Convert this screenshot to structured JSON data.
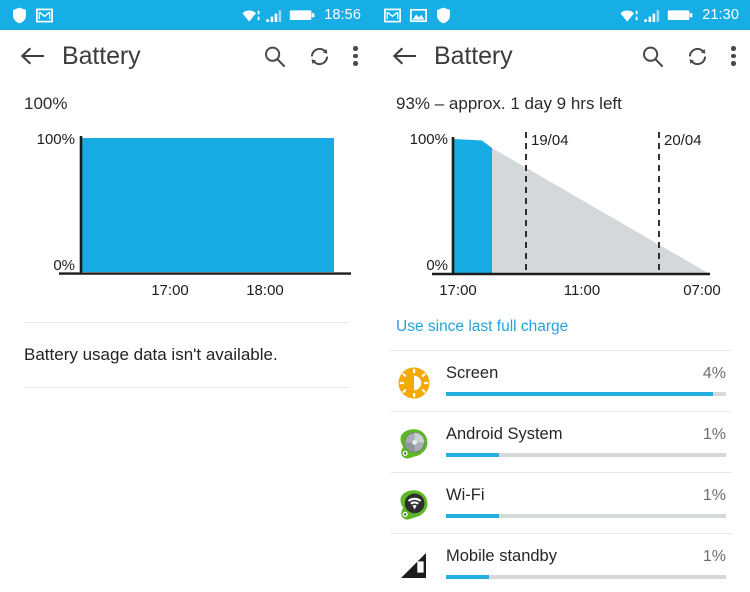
{
  "left": {
    "statusbar": {
      "icons": [
        "shield-icon",
        "gmail-icon"
      ],
      "wifi_icon": "wifi-icon",
      "signal_icon": "signal-bars-icon",
      "battery_icon": "battery-icon",
      "time": "18:56"
    },
    "toolbar": {
      "back_icon": "back-arrow-icon",
      "title": "Battery",
      "search_icon": "search-icon",
      "refresh_icon": "refresh-icon",
      "overflow_icon": "overflow-menu-icon"
    },
    "summary": "100%",
    "no_data_text": "Battery usage data isn't available.",
    "chart_data": {
      "type": "area",
      "title": "100%",
      "xlabel": "",
      "ylabel": "",
      "ylim": [
        0,
        100
      ],
      "y_ticks": [
        "0%",
        "100%"
      ],
      "x_ticks": [
        "17:00",
        "18:00"
      ],
      "grid": false,
      "legend": "none",
      "series": [
        {
          "name": "Battery level",
          "color": "#16ACE3",
          "points": [
            {
              "x": "16:20",
              "y": 100
            },
            {
              "x": "18:40",
              "y": 100
            }
          ]
        }
      ]
    }
  },
  "right": {
    "statusbar": {
      "icons": [
        "gmail-icon",
        "photos-icon",
        "shield-icon"
      ],
      "wifi_icon": "wifi-icon",
      "signal_icon": "signal-bars-icon",
      "battery_icon": "battery-icon",
      "time": "21:30"
    },
    "toolbar": {
      "back_icon": "back-arrow-icon",
      "title": "Battery",
      "search_icon": "search-icon",
      "refresh_icon": "refresh-icon",
      "overflow_icon": "overflow-menu-icon"
    },
    "summary": "93% – approx. 1 day 9 hrs left",
    "link_label": "Use since last full charge",
    "chart_data": {
      "type": "area",
      "title": "93% – approx. 1 day 9 hrs left",
      "xlabel": "",
      "ylabel": "",
      "ylim": [
        0,
        100
      ],
      "y_ticks": [
        "0%",
        "100%"
      ],
      "x_ticks": [
        "17:00",
        "11:00",
        "07:00"
      ],
      "annotations": [
        {
          "label": "19/04",
          "x_fraction": 0.3,
          "style": "dashed-vline"
        },
        {
          "label": "20/04",
          "x_fraction": 0.83,
          "style": "dashed-vline"
        }
      ],
      "grid": false,
      "legend": "none",
      "series": [
        {
          "name": "Battery level (recorded)",
          "color": "#16ACE3",
          "points": [
            {
              "x": "17:00",
              "y": 100
            },
            {
              "x": "18:30",
              "y": 97
            },
            {
              "x": "19:30",
              "y": 93
            }
          ]
        },
        {
          "name": "Projected remaining",
          "color": "#D3D9DA",
          "points": [
            {
              "x": "19:30",
              "y": 93
            },
            {
              "x": "07:00",
              "y": 0
            }
          ]
        }
      ]
    },
    "usage": {
      "items": [
        {
          "name": "Screen",
          "percent": "4%",
          "fill": 0.955,
          "icon": "screen-brightness-icon"
        },
        {
          "name": "Android System",
          "percent": "1%",
          "fill": 0.19,
          "icon": "android-system-icon"
        },
        {
          "name": "Wi-Fi",
          "percent": "1%",
          "fill": 0.19,
          "icon": "wifi-app-icon"
        },
        {
          "name": "Mobile standby",
          "percent": "1%",
          "fill": 0.155,
          "icon": "mobile-signal-icon"
        }
      ]
    }
  },
  "colors": {
    "accent_blue": "#17ADE5",
    "chart_blue": "#16ACE3",
    "projection_gray": "#D3D9DA",
    "link_blue": "#23A3DC",
    "text_dark": "#262626"
  }
}
